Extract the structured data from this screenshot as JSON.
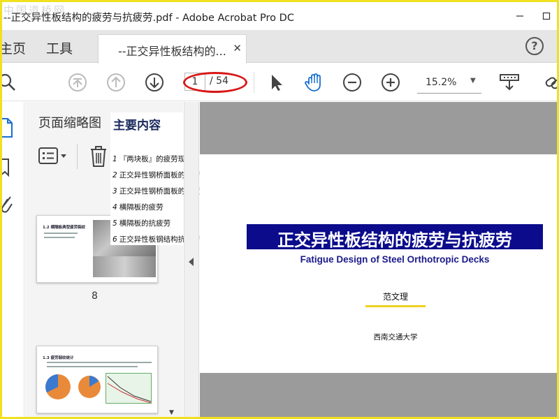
{
  "watermark": "中国道桥网",
  "window": {
    "title": "--正交异性板结构的疲劳与抗疲劳.pdf - Adobe Acrobat Pro DC"
  },
  "menu": {
    "home": "主页",
    "tools": "工具"
  },
  "tab": {
    "label": "--正交异性板结构的...",
    "close_icon": "close-icon"
  },
  "help": {
    "icon": "help-icon",
    "label": "?"
  },
  "toolbar": {
    "icons": [
      "search-icon",
      "first-page-icon",
      "previous-page-icon",
      "next-page-icon",
      "select-arrow-icon",
      "hand-icon",
      "zoom-out-icon",
      "zoom-in-icon",
      "scroll-mode-icon",
      "link-icon"
    ],
    "page_current": "1",
    "page_total": "/ 54",
    "zoom": "15.2%"
  },
  "left_strip": {
    "icons": [
      "page-thumbnails-icon",
      "bookmarks-icon",
      "attachments-icon"
    ]
  },
  "thumbnails": {
    "title": "页面缩略图",
    "thumb_8_heading": "1.2 横隔板典型疲劳裂纹",
    "thumb_8_number": "8",
    "thumb_9_heading": "1.3 疲劳裂纹统计"
  },
  "contents": {
    "title": "主要内容",
    "items": [
      {
        "num": "1",
        "text": "『两块板』的疲劳现象"
      },
      {
        "num": "2",
        "text": "正交异性钢桥面板的疲劳"
      },
      {
        "num": "3",
        "text": "正交异性钢桥面板的抗疲劳"
      },
      {
        "num": "4",
        "text": "横隔板的疲劳"
      },
      {
        "num": "5",
        "text": "横隔板的抗疲劳"
      },
      {
        "num": "6",
        "text": "正交异性板钢结构抗疲劳设计的思考"
      }
    ]
  },
  "document": {
    "title": "正交异性板结构的疲劳与抗疲劳",
    "subtitle": "Fatigue Design of Steel Orthotropic Decks",
    "author": "范文理",
    "affiliation": "西南交通大学"
  },
  "colors": {
    "frame_yellow": "#f0e020",
    "banner_navy": "#0b0b8c",
    "annotation_red": "#d81818",
    "hand_tool_blue": "#1a6fd0",
    "viewer_gray": "#9b9b9b"
  }
}
